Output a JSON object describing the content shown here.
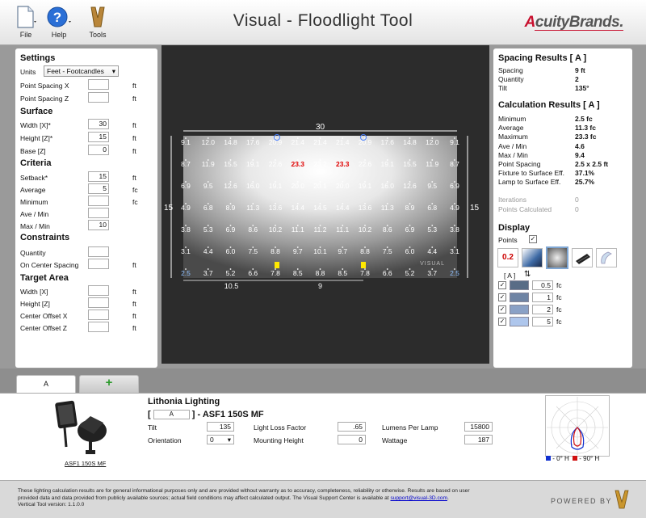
{
  "toolbar": {
    "file_label": "File",
    "help_label": "Help",
    "tools_label": "Tools"
  },
  "app_title": "Visual - Floodlight Tool",
  "brand": {
    "name_prefix": "A",
    "name_rest": "cuityBrands."
  },
  "settings": {
    "title": "Settings",
    "units_label": "Units",
    "units_value": "Feet - Footcandles",
    "point_spacing_x_label": "Point Spacing X",
    "point_spacing_x_value": "",
    "point_spacing_x_unit": "ft",
    "point_spacing_z_label": "Point Spacing Z",
    "point_spacing_z_value": "",
    "point_spacing_z_unit": "ft"
  },
  "surface": {
    "title": "Surface",
    "width_label": "Width  [X]*",
    "width_value": "30",
    "width_unit": "ft",
    "height_label": "Height [Z]*",
    "height_value": "15",
    "height_unit": "ft",
    "base_label": "Base  [Z]",
    "base_value": "0",
    "base_unit": "ft"
  },
  "criteria": {
    "title": "Criteria",
    "setback_label": "Setback*",
    "setback_value": "15",
    "setback_unit": "ft",
    "average_label": "Average",
    "average_value": "5",
    "average_unit": "fc",
    "minimum_label": "Minimum",
    "minimum_value": "",
    "minimum_unit": "fc",
    "avemin_label": "Ave / Min",
    "avemin_value": "",
    "maxmin_label": "Max / Min",
    "maxmin_value": "10"
  },
  "constraints": {
    "title": "Constraints",
    "quantity_label": "Quantity",
    "quantity_value": "",
    "ocs_label": "On Center Spacing",
    "ocs_value": "",
    "ocs_unit": "ft"
  },
  "target_area": {
    "title": "Target Area",
    "width_label": "Width [X]",
    "width_value": "",
    "width_unit": "ft",
    "height_label": "Height [Z]",
    "height_value": "",
    "height_unit": "ft",
    "cox_label": "Center Offset X",
    "cox_value": "",
    "cox_unit": "ft",
    "coz_label": "Center Offset Z",
    "coz_value": "",
    "coz_unit": "ft"
  },
  "spacing_results": {
    "title": "Spacing Results  [ A ]",
    "rows": [
      {
        "key": "Spacing",
        "value": "9  ft"
      },
      {
        "key": "Quantity",
        "value": "2"
      },
      {
        "key": "Tilt",
        "value": "135°"
      }
    ]
  },
  "calc_results": {
    "title": "Calculation Results  [ A ]",
    "rows": [
      {
        "key": "Minimum",
        "value": "2.5  fc"
      },
      {
        "key": "Average",
        "value": "11.3  fc"
      },
      {
        "key": "Maximum",
        "value": "23.3  fc"
      },
      {
        "key": "Ave / Min",
        "value": "4.6"
      },
      {
        "key": "Max / Min",
        "value": "9.4"
      },
      {
        "key": "Point Spacing",
        "value": "2.5 x 2.5  ft"
      },
      {
        "key": "Fixture to Surface Eff.",
        "value": "37.1%"
      },
      {
        "key": "Lamp to Surface Eff.",
        "value": "25.7%"
      }
    ],
    "gray_rows": [
      {
        "key": "Iterations",
        "value": "0"
      },
      {
        "key": "Points Calculated",
        "value": "0"
      }
    ]
  },
  "display": {
    "title": "Display",
    "points_label": "Points",
    "points_checked": true,
    "points_icon_text": "0.2",
    "iso_header": "[ A ]",
    "iso_levels": [
      {
        "value": "0.5",
        "unit": "fc",
        "color": "#596c86"
      },
      {
        "value": "1",
        "unit": "fc",
        "color": "#6f84a4"
      },
      {
        "value": "2",
        "unit": "fc",
        "color": "#8aa1c6"
      },
      {
        "value": "5",
        "unit": "fc",
        "color": "#aec6ec"
      }
    ]
  },
  "grid": {
    "width_label": "30",
    "height_label_left": "15",
    "height_label_right": "15",
    "spacing_label": "9",
    "offset_label": "10.5",
    "watermark": "VISUAL",
    "min_value": 2.5,
    "max_value": 23.3,
    "rows": [
      [
        "9.1",
        "12.0",
        "14.8",
        "17.6",
        "20.9",
        "21.4",
        "21.4",
        "21.4",
        "20.9",
        "17.6",
        "14.8",
        "12.0",
        "9.1"
      ],
      [
        "8.7",
        "11.9",
        "15.5",
        "19.1",
        "22.6",
        "23.3",
        "23.2",
        "23.3",
        "22.6",
        "19.1",
        "15.5",
        "11.9",
        "8.7"
      ],
      [
        "6.9",
        "9.5",
        "12.6",
        "16.0",
        "19.1",
        "20.0",
        "20.1",
        "20.0",
        "19.1",
        "16.0",
        "12.6",
        "9.5",
        "6.9"
      ],
      [
        "4.9",
        "6.8",
        "8.9",
        "11.3",
        "13.6",
        "14.4",
        "14.5",
        "14.4",
        "13.6",
        "11.3",
        "8.9",
        "6.8",
        "4.9"
      ],
      [
        "3.8",
        "5.3",
        "6.9",
        "8.6",
        "10.2",
        "11.1",
        "11.2",
        "11.1",
        "10.2",
        "8.6",
        "6.9",
        "5.3",
        "3.8"
      ],
      [
        "3.1",
        "4.4",
        "6.0",
        "7.5",
        "8.8",
        "9.7",
        "10.1",
        "9.7",
        "8.8",
        "7.5",
        "6.0",
        "4.4",
        "3.1"
      ],
      [
        "2.5",
        "3.7",
        "5.2",
        "6.6",
        "7.8",
        "8.5",
        "8.8",
        "8.5",
        "7.8",
        "6.6",
        "5.2",
        "3.7",
        "2.5"
      ]
    ],
    "max_cells": [
      [
        1,
        5
      ],
      [
        1,
        7
      ]
    ],
    "min_cells": [
      [
        6,
        0
      ],
      [
        6,
        12
      ]
    ]
  },
  "tabs": {
    "active_label": "A",
    "add_label": "+"
  },
  "fixture": {
    "manufacturer": "Lithonia Lighting",
    "bracket_open": "[",
    "tag": "A",
    "bracket_close": "]",
    "model": "- ASF1 150S MF",
    "caption": "ASF1 150S MF",
    "tilt_label": "Tilt",
    "tilt_value": "135",
    "orientation_label": "Orientation",
    "orientation_value": "0",
    "llf_label": "Light Loss Factor",
    "llf_value": ".65",
    "mh_label": "Mounting Height",
    "mh_value": "0",
    "lpl_label": "Lumens Per Lamp",
    "lpl_value": "15800",
    "wattage_label": "Wattage",
    "wattage_value": "187",
    "legend_0": "- 0° H",
    "legend_90": "- 90° H"
  },
  "footer": {
    "disclaimer": "These lighting calculation results are for general informational purposes only and are provided without warranty as to accuracy, completeness, reliability or otherwise. Results are based on user provided data and data provided from publicly available sources; actual field conditions may affect calculated output. The Visual Support Center is available at ",
    "support_link": "support@visual-3D.com",
    "disclaimer_end": ".",
    "version": "Vertical Tool version: 1.1.0.0",
    "powered_by": "POWERED BY"
  },
  "colors": {
    "max_text": "#e00000",
    "accent_red": "#c8102e",
    "fixture_marker": "#ffe800",
    "circle_marker": "#4a80ff"
  }
}
